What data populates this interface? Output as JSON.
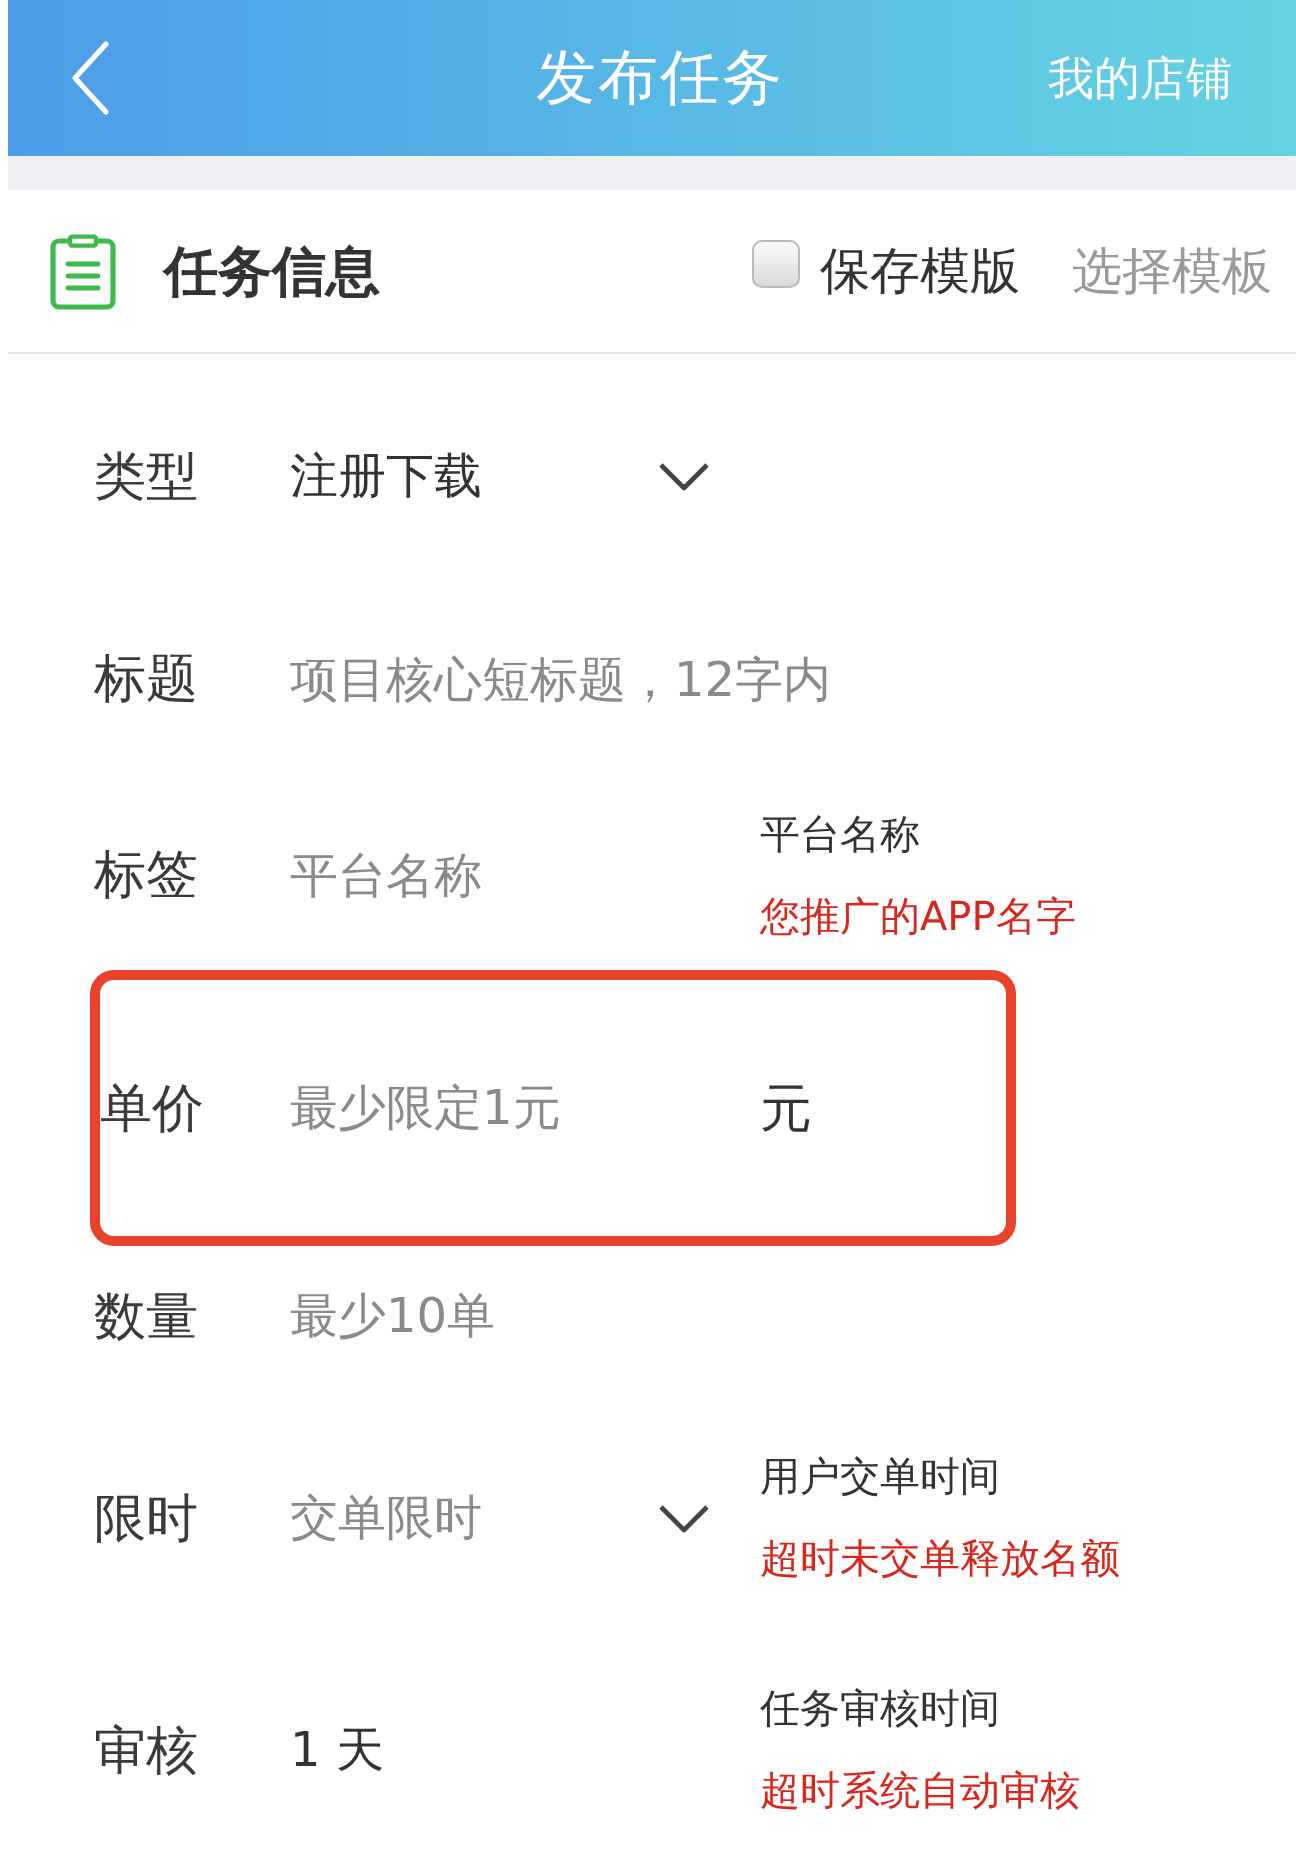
{
  "header": {
    "title": "发布任务",
    "action": "我的店铺"
  },
  "section": {
    "title": "任务信息",
    "save_template": {
      "label": "保存模版",
      "checked": false
    },
    "select_template": "选择模板"
  },
  "rows": [
    {
      "label": "类型",
      "kind": "select",
      "value": "注册下载",
      "highlighted": false
    },
    {
      "label": "标题",
      "kind": "input",
      "placeholder": "项目核心短标题，12字内",
      "highlighted": false
    },
    {
      "label": "标签",
      "kind": "input",
      "placeholder": "平台名称",
      "hint": {
        "title": "平台名称",
        "note": "您推广的APP名字"
      },
      "highlighted": false
    },
    {
      "label": "单价",
      "kind": "input",
      "placeholder": "最少限定1元",
      "unit": "元",
      "highlighted": true
    },
    {
      "label": "数量",
      "kind": "input",
      "placeholder": "最少10单",
      "highlighted": false
    },
    {
      "label": "限时",
      "kind": "select",
      "placeholder": "交单限时",
      "hint": {
        "title": "用户交单时间",
        "note": "超时未交单释放名额"
      },
      "highlighted": false
    },
    {
      "label": "审核",
      "kind": "text",
      "value": "1 天",
      "hint": {
        "title": "任务审核时间",
        "note": "超时系统自动审核"
      },
      "highlighted": false
    }
  ]
}
